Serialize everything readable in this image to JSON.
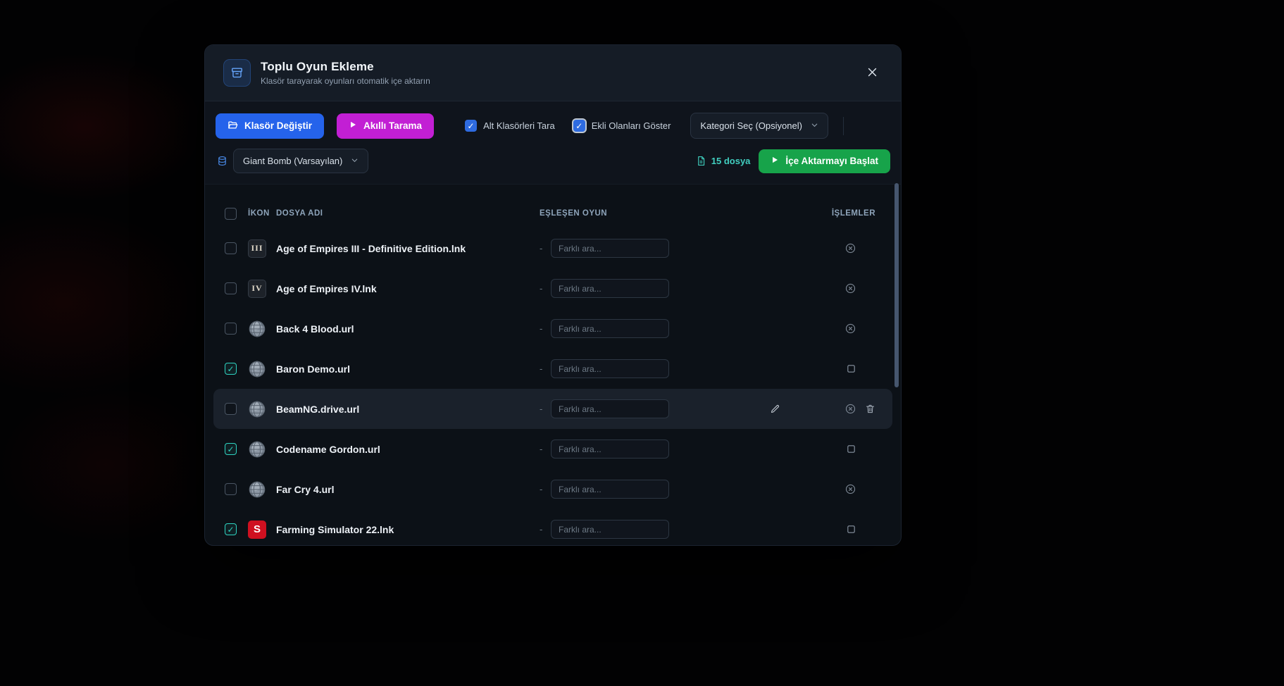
{
  "dialog": {
    "title": "Toplu Oyun Ekleme",
    "subtitle": "Klasör tarayarak oyunları otomatik içe aktarın"
  },
  "toolbar": {
    "change_folder_label": "Klasör Değiştir",
    "smart_scan_label": "Akıllı Tarama",
    "subfolders_checkbox": {
      "label": "Alt Klasörleri Tara",
      "checked": true
    },
    "show_added_checkbox": {
      "label": "Ekli Olanları Göster",
      "checked": true,
      "focused": true
    },
    "category_select_value": "Kategori Seç (Opsiyonel)"
  },
  "source_bar": {
    "source_select_value": "Giant Bomb (Varsayılan)",
    "file_count": "15 dosya",
    "start_import_label": "İçe Aktarmayı Başlat"
  },
  "table": {
    "select_all_checked": false,
    "headers": {
      "icon": "İKON",
      "file_name": "DOSYA ADI",
      "matched_game": "EŞLEŞEN OYUN",
      "actions": "İŞLEMLER"
    },
    "search_placeholder": "Farklı ara...",
    "rows": [
      {
        "checked": false,
        "icon": "aoe3",
        "icon_text": "III",
        "file_name": "Age of Empires III - Definitive Edition.lnk",
        "matched": "-",
        "search_value": "",
        "actions": [
          "remove"
        ],
        "highlighted": false
      },
      {
        "checked": false,
        "icon": "aoe4",
        "icon_text": "IV",
        "file_name": "Age of Empires IV.lnk",
        "matched": "-",
        "search_value": "",
        "actions": [
          "remove"
        ],
        "highlighted": false
      },
      {
        "checked": false,
        "icon": "globe",
        "icon_text": "",
        "file_name": "Back 4 Blood.url",
        "matched": "-",
        "search_value": "",
        "actions": [
          "remove"
        ],
        "highlighted": false
      },
      {
        "checked": true,
        "icon": "globe",
        "icon_text": "",
        "file_name": "Baron Demo.url",
        "matched": "-",
        "search_value": "",
        "actions": [
          "select"
        ],
        "highlighted": false
      },
      {
        "checked": false,
        "icon": "globe",
        "icon_text": "",
        "file_name": "BeamNG.drive.url",
        "matched": "-",
        "search_value": "",
        "actions": [
          "edit",
          "remove",
          "delete"
        ],
        "highlighted": true
      },
      {
        "checked": true,
        "icon": "globe",
        "icon_text": "",
        "file_name": "Codename Gordon.url",
        "matched": "-",
        "search_value": "",
        "actions": [
          "select"
        ],
        "highlighted": false
      },
      {
        "checked": false,
        "icon": "globe",
        "icon_text": "",
        "file_name": "Far Cry 4.url",
        "matched": "-",
        "search_value": "",
        "actions": [
          "remove"
        ],
        "highlighted": false
      },
      {
        "checked": true,
        "icon": "fs22",
        "icon_text": "S",
        "file_name": "Farming Simulator 22.lnk",
        "matched": "-",
        "search_value": "",
        "actions": [
          "select"
        ],
        "highlighted": false
      }
    ]
  },
  "icons": {
    "header": "drive-icon",
    "close": "close-icon",
    "change_folder": "folder-icon",
    "smart_scan": "play-icon",
    "source": "database-icon",
    "file_count": "file-icon",
    "start_import": "play-icon",
    "row_generic": "globe-icon",
    "row_actions": [
      "edit-icon",
      "remove-match-icon",
      "select-square-icon",
      "trash-icon"
    ]
  },
  "colors": {
    "accent_blue": "#2563eb",
    "accent_magenta": "#c21fd4",
    "accent_green": "#17a34a",
    "accent_teal": "#41cfc0",
    "dialog_bg": "#0c1117",
    "header_bg": "#151c26",
    "row_highlight": "#1a212b"
  }
}
